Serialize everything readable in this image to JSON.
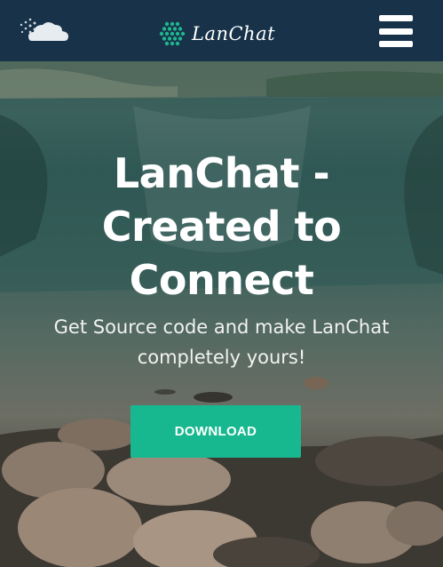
{
  "navbar": {
    "logo_text": "LanChat",
    "icons": {
      "weather": "cloud-icon",
      "logo": "hex-dots-icon",
      "menu": "hamburger-menu-icon"
    },
    "colors": {
      "background": "#173249",
      "logo_accent": "#1fb58f"
    }
  },
  "hero": {
    "title_line1": "LanChat -",
    "title_line2": "Created to",
    "title_line3": "Connect",
    "subtitle_line1": "Get Source code and make LanChat",
    "subtitle_line2": "completely yours!",
    "download_label": "DOWNLOAD",
    "colors": {
      "button": "#17b88f"
    }
  }
}
